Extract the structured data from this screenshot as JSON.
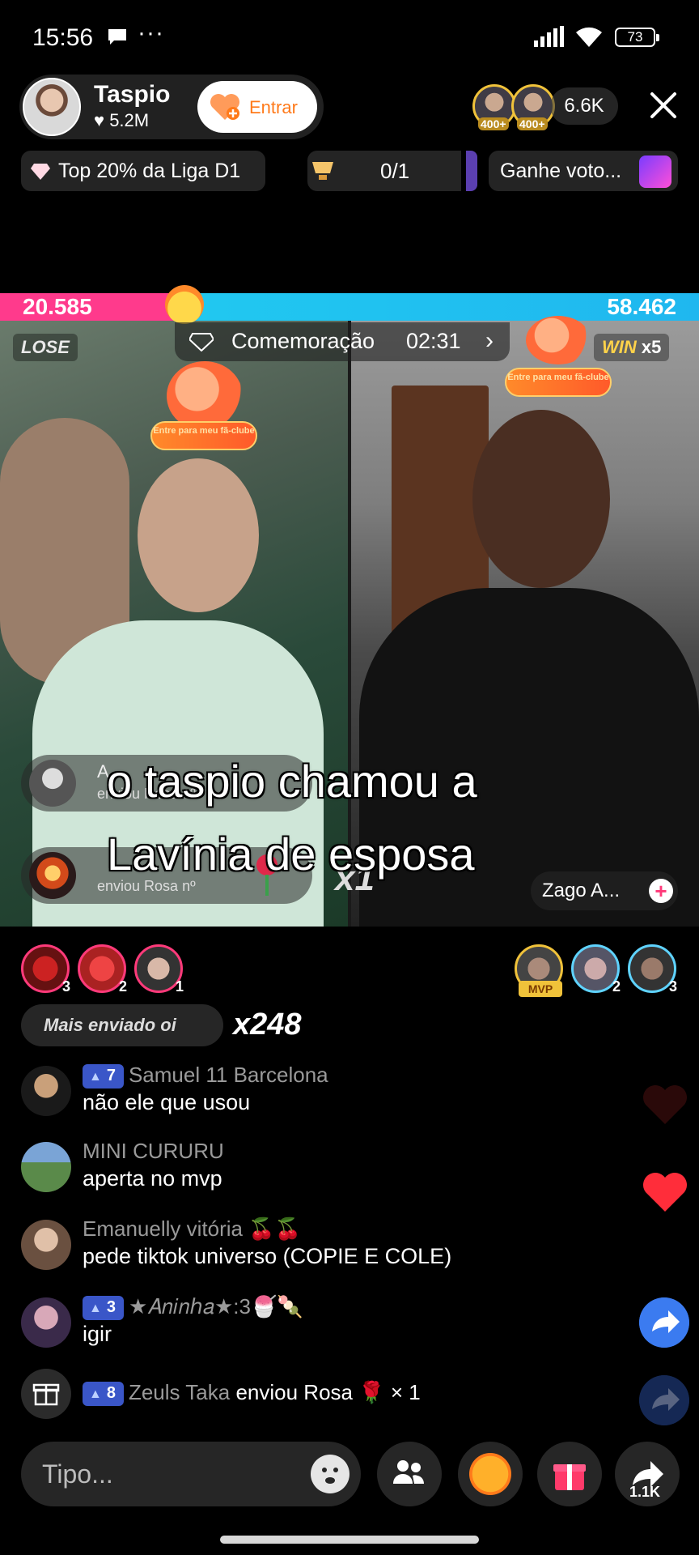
{
  "status_bar": {
    "time": "15:56",
    "dots": "···",
    "battery": "73"
  },
  "host": {
    "name": "Taspio",
    "likes": "5.2M",
    "join_label": "Entrar"
  },
  "viewers": {
    "badge1": "400+",
    "badge2": "400+",
    "count": "6.6K"
  },
  "pills": {
    "league": "Top 20% da Liga D1",
    "progress": "0/1",
    "votes": "Ganhe voto..."
  },
  "battle": {
    "left_score": "20.585",
    "right_score": "58.462",
    "left_result": "LOSE",
    "right_result": "WIN",
    "right_streak": "x5",
    "celebration_label": "Comemoração",
    "celebration_timer": "02:31",
    "fan_club_label": "Entre para meu fã-clube",
    "opponent_name": "Zago A..."
  },
  "gifts": [
    {
      "name": "A...",
      "detail": "enviou Rosa nº"
    },
    {
      "name": "",
      "detail": "enviou Rosa nº"
    }
  ],
  "gift_multiplier": "x1",
  "caption": {
    "line1": "o taspio chamou a",
    "line2": "Lavínia de esposa"
  },
  "supporters": {
    "left_ranks": [
      "3",
      "2",
      "1"
    ],
    "right_mvp": "MVP",
    "right_ranks": [
      "2",
      "3"
    ]
  },
  "most_sent": {
    "label": "Mais enviado oi",
    "count": "x248"
  },
  "chat": [
    {
      "level": "7",
      "user": "Samuel 11 Barcelona",
      "text": "não ele que usou"
    },
    {
      "level": "",
      "user": "MINI CURURU",
      "text": "aperta no mvp"
    },
    {
      "level": "",
      "user": "Emanuelly vitória 🍒🍒",
      "text": "pede tiktok universo (COPIE E COLE)"
    },
    {
      "level": "3",
      "user": "★𝐴𝑛𝑖𝑛ℎ𝑎★:3🍧🍡",
      "text": "igir"
    }
  ],
  "gift_log": {
    "level": "8",
    "user": "Zeuls Taka",
    "text": "enviou Rosa 🌹 × 1"
  },
  "bottom_bar": {
    "placeholder": "Tipo...",
    "share_count": "1.1K"
  },
  "colors": {
    "accent_pink": "#ff3a8c",
    "accent_blue": "#1fb7ef",
    "level_badge": "#3a56c8",
    "heart": "#ff2d3a"
  }
}
